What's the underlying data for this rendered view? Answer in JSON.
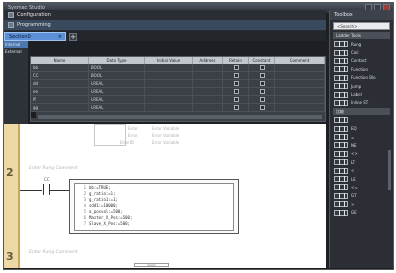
{
  "window": {
    "title": "Sysmac Studio"
  },
  "nav": {
    "items": [
      {
        "label": "Configuration",
        "icon": "config-icon"
      },
      {
        "label": "Programming",
        "icon": "program-icon"
      }
    ]
  },
  "tabs": [
    {
      "label": "Section0"
    }
  ],
  "left_strip": {
    "items": [
      "Internal",
      "External"
    ]
  },
  "variables": {
    "columns": [
      "Name",
      "Data Type",
      "Initial Value",
      "Address",
      "Retain",
      "Constant",
      "Comment"
    ],
    "rows": [
      {
        "name": "bb",
        "type": "BOOL"
      },
      {
        "name": "CC",
        "type": "BOOL"
      },
      {
        "name": "dd",
        "type": "LREAL"
      },
      {
        "name": "ee",
        "type": "LREAL"
      },
      {
        "name": "ff",
        "type": "LREAL"
      },
      {
        "name": "gg",
        "type": "LREAL"
      }
    ]
  },
  "ladder": {
    "rung1_faint": [
      "Error",
      "Error",
      "ErrorID"
    ],
    "rung1_faint_right": [
      "Error Variable",
      "Error Variable",
      "Error Variable"
    ],
    "rung2": {
      "number": "2",
      "comment": "Enter Rung Comment",
      "contact_label": "CC",
      "code": [
        {
          "n": "1",
          "text": "bb:=TRUE;"
        },
        {
          "n": "2",
          "text": "g_ratio:=1;"
        },
        {
          "n": "3",
          "text": "g_ratio1:=1;"
        },
        {
          "n": "4",
          "text": "sdd1:=10000;"
        },
        {
          "n": "5",
          "text": "a_posval:=500;"
        },
        {
          "n": "6",
          "text": "Master_X_Pos:=500;"
        },
        {
          "n": "7",
          "text": "Slave_X_Pos:=500;"
        }
      ]
    },
    "rung3": {
      "number": "3",
      "comment": "Enter Rung Comment"
    },
    "scroll_label": "zoom"
  },
  "toolbox": {
    "title": "Toolbox",
    "search": "<Search>",
    "group1": "Ladder Tools",
    "ladder_tools": [
      {
        "label": "Rung"
      },
      {
        "label": "Coil"
      },
      {
        "label": "Contact"
      },
      {
        "label": "Function"
      },
      {
        "label": "Function Blo"
      },
      {
        "label": "Jump"
      },
      {
        "label": "Label"
      },
      {
        "label": "Inline ST"
      }
    ],
    "group2": "比較",
    "compare_tools": [
      {
        "label": ""
      },
      {
        "label": "EQ"
      },
      {
        "label": "="
      },
      {
        "label": "NE"
      },
      {
        "label": "<>"
      },
      {
        "label": "LT"
      },
      {
        "label": "<"
      },
      {
        "label": "LE"
      },
      {
        "label": "<="
      },
      {
        "label": "GT"
      },
      {
        "label": ">"
      },
      {
        "label": "GE"
      }
    ]
  }
}
